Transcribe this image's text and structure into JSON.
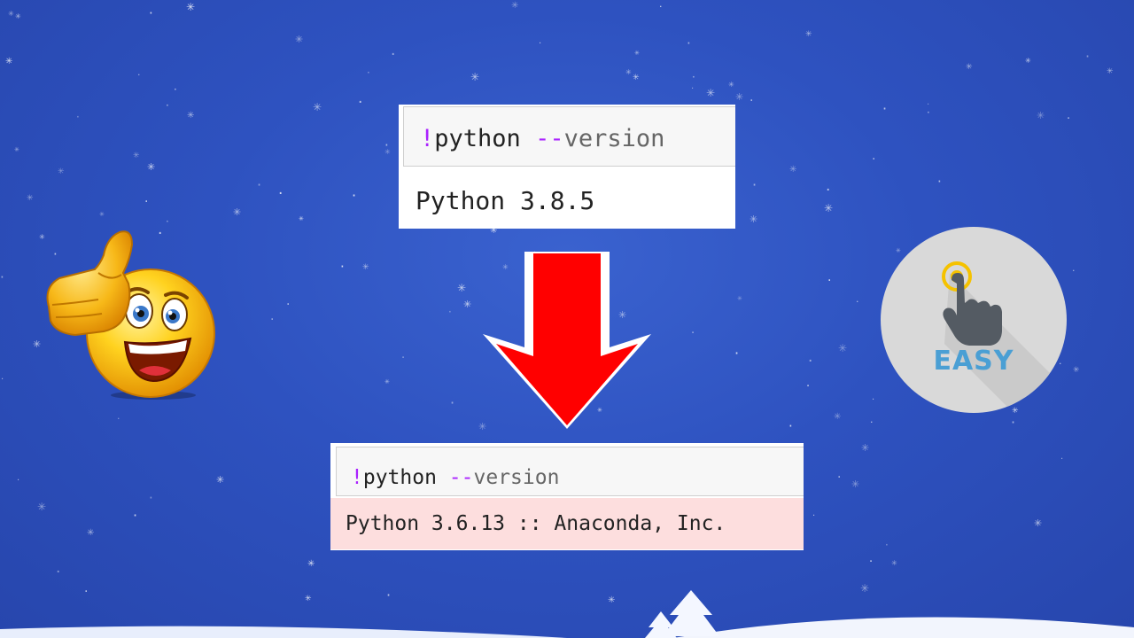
{
  "cell_top": {
    "input_bang": "!",
    "input_cmd": "python ",
    "input_dash": "--",
    "input_flag": "version",
    "output": "Python 3.8.5"
  },
  "cell_bottom": {
    "input_bang": "!",
    "input_cmd": "python ",
    "input_dash": "--",
    "input_flag": "version",
    "output": "Python 3.6.13 :: Anaconda, Inc."
  },
  "badge": {
    "label": "EASY",
    "icon": "tap-hand-icon"
  },
  "emoji": {
    "icon": "thumbs-up-smiley-icon"
  },
  "arrow": {
    "icon": "down-arrow-icon",
    "color": "#ff0000"
  },
  "colors": {
    "background": "#2e52c0",
    "badge_bg": "#d9d9d9",
    "badge_text": "#4a9fd4",
    "error_output_bg": "#fddede"
  }
}
